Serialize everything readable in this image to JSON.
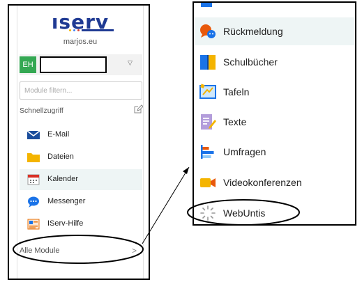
{
  "sidebar": {
    "logo": "ıserv",
    "domain": "marjos.eu",
    "user": {
      "initials": "EH",
      "avatar_color": "#34a853"
    },
    "filter": {
      "placeholder": "Module filtern..."
    },
    "quick_access_label": "Schnellzugriff",
    "items": [
      {
        "label": "E-Mail",
        "icon": "mail-icon"
      },
      {
        "label": "Dateien",
        "icon": "folder-icon"
      },
      {
        "label": "Kalender",
        "icon": "calendar-icon"
      },
      {
        "label": "Messenger",
        "icon": "messenger-icon"
      },
      {
        "label": "IServ-Hilfe",
        "icon": "help-icon"
      }
    ],
    "all_modules_label": "Alle Module"
  },
  "modules_menu": {
    "items": [
      {
        "label": "Rückmeldung",
        "icon": "feedback-icon"
      },
      {
        "label": "Schulbücher",
        "icon": "books-icon"
      },
      {
        "label": "Tafeln",
        "icon": "board-icon"
      },
      {
        "label": "Texte",
        "icon": "text-icon"
      },
      {
        "label": "Umfragen",
        "icon": "survey-icon"
      },
      {
        "label": "Videokonferenzen",
        "icon": "video-icon"
      },
      {
        "label": "WebUntis",
        "icon": "webuntis-icon"
      }
    ]
  },
  "colors": {
    "brand": "#1f3a93",
    "active_row": "#eef5f5",
    "avatar": "#34a853"
  }
}
